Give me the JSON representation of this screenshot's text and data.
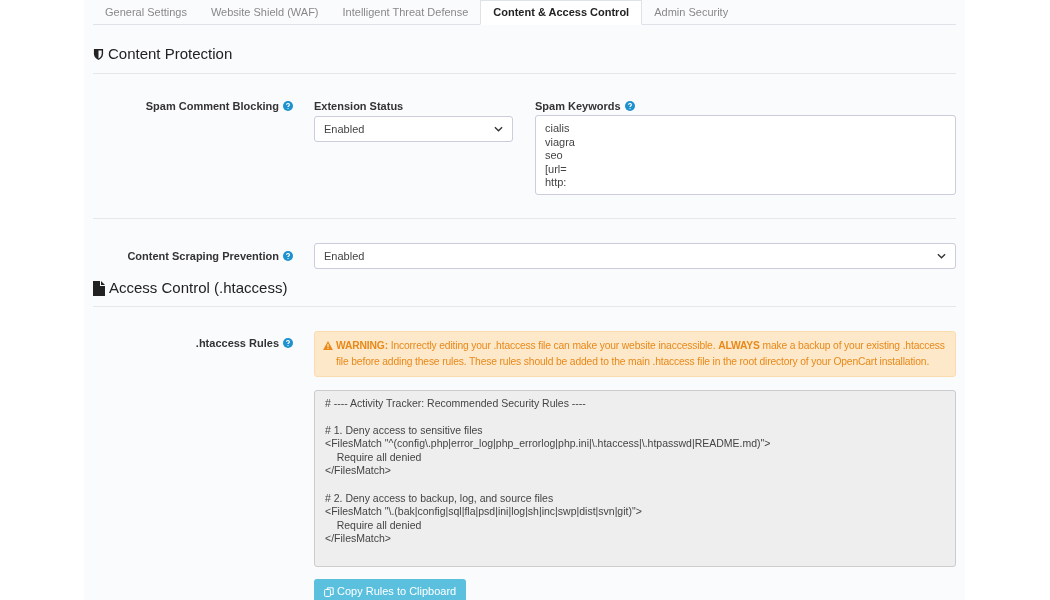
{
  "tabs": [
    {
      "label": "General Settings",
      "selected": false
    },
    {
      "label": "Website Shield (WAF)",
      "selected": false
    },
    {
      "label": "Intelligent Threat Defense",
      "selected": false
    },
    {
      "label": "Content & Access Control",
      "selected": true
    },
    {
      "label": "Admin Security",
      "selected": false
    }
  ],
  "sections": [
    {
      "title": "Content Protection",
      "kind": "shield",
      "rows": [
        {
          "kind": "spam",
          "label": "Spam Comment Blocking",
          "status_label": "Extension Status",
          "status_value": "Enabled",
          "keywords_label": "Spam Keywords",
          "keywords": [
            "cialis",
            "viagra",
            "seo",
            "[url=",
            "http:"
          ]
        },
        {
          "kind": "select",
          "label": "Content Scraping Prevention",
          "value": "Enabled"
        }
      ]
    },
    {
      "title": "Access Control (.htaccess)",
      "kind": "file",
      "rows": [
        {
          "kind": "htaccess",
          "label": ".htaccess Rules",
          "warning": "**WARNING:** Incorrectly editing your .htaccess file can make your website inaccessible. **ALWAYS** make a backup of your existing .htaccess file before adding these rules. These rules should be added to the main .htaccess file in the root directory of your OpenCart installation.",
          "code": [
            [
              "# ---- Activity Tracker: Recommended Security Rules ----"
            ],
            [
              "# 1. Deny access to sensitive files",
              "<FilesMatch \"^(config\\.php|error_log|php_errorlog|php.ini|\\.htaccess|\\.htpasswd|README.md)\">",
              "    Require all denied",
              "</FilesMatch>"
            ],
            [
              "# 2. Deny access to backup, log, and source files",
              "<FilesMatch \"\\.(bak|config|sql|fla|psd|ini|log|sh|inc|swp|dist|svn|git)\">",
              "    Require all denied",
              "</FilesMatch>"
            ]
          ],
          "button": "Copy Rules to Clipboard"
        }
      ]
    }
  ]
}
